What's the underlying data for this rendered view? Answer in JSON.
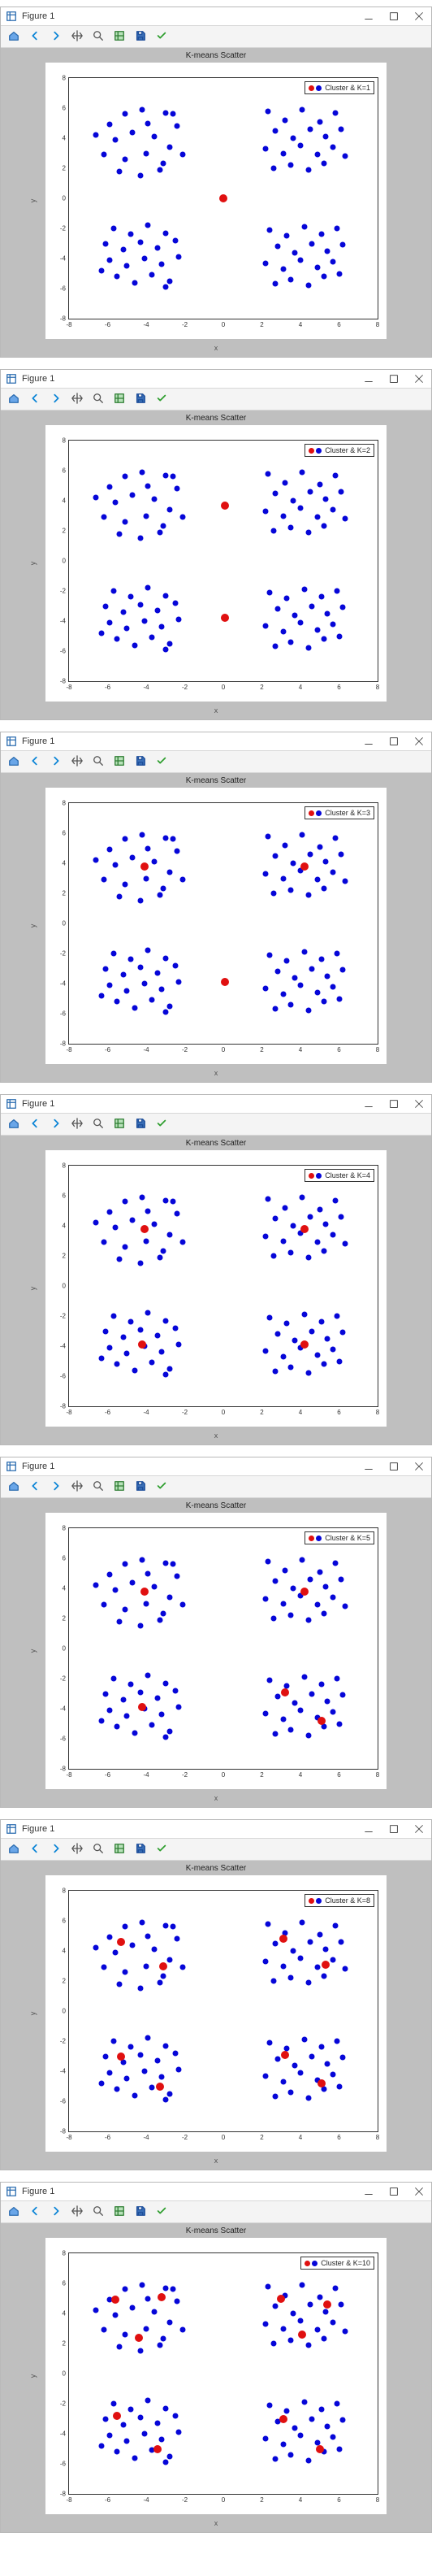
{
  "figure_window": {
    "title": "Figure 1",
    "buttons": {
      "minimize": "Minimize",
      "maximize": "Maximize",
      "close": "Close"
    },
    "toolbar": [
      {
        "name": "home-icon",
        "tip": "Reset original view"
      },
      {
        "name": "back-icon",
        "tip": "Back"
      },
      {
        "name": "forward-icon",
        "tip": "Forward"
      },
      {
        "name": "pan-icon",
        "tip": "Pan"
      },
      {
        "name": "zoom-icon",
        "tip": "Zoom"
      },
      {
        "name": "configure-icon",
        "tip": "Configure subplots"
      },
      {
        "name": "save-icon",
        "tip": "Save"
      },
      {
        "name": "check-icon",
        "tip": "Apply"
      }
    ]
  },
  "common_chart": {
    "title": "K-means Scatter",
    "xlabel": "x",
    "ylabel": "y",
    "xlim": [
      -8,
      8
    ],
    "ylim": [
      -8,
      8
    ],
    "xticks": [
      -8,
      -6,
      -4,
      -2,
      0,
      2,
      4,
      6,
      8
    ],
    "yticks": [
      -8,
      -6,
      -4,
      -2,
      0,
      2,
      4,
      6,
      8
    ],
    "legend_colors": {
      "centroid": "#e01010",
      "point": "#0606d8"
    }
  },
  "blue_points": [
    [
      -5.9,
      4.9
    ],
    [
      -5.1,
      5.6
    ],
    [
      -4.2,
      5.9
    ],
    [
      -3.0,
      5.7
    ],
    [
      -2.4,
      4.8
    ],
    [
      -5.6,
      3.9
    ],
    [
      -4.7,
      4.4
    ],
    [
      -3.6,
      4.1
    ],
    [
      -2.8,
      3.4
    ],
    [
      -6.2,
      2.9
    ],
    [
      -5.1,
      2.6
    ],
    [
      -4.0,
      3.0
    ],
    [
      -3.1,
      2.3
    ],
    [
      -2.1,
      2.9
    ],
    [
      -5.4,
      1.8
    ],
    [
      -4.3,
      1.5
    ],
    [
      -3.3,
      1.9
    ],
    [
      -6.6,
      4.2
    ],
    [
      -3.9,
      5.0
    ],
    [
      -2.6,
      5.6
    ],
    [
      2.3,
      5.8
    ],
    [
      3.2,
      5.2
    ],
    [
      4.1,
      5.9
    ],
    [
      5.0,
      5.1
    ],
    [
      5.8,
      5.7
    ],
    [
      2.7,
      4.5
    ],
    [
      3.6,
      4.0
    ],
    [
      4.5,
      4.6
    ],
    [
      5.3,
      4.1
    ],
    [
      6.1,
      4.6
    ],
    [
      2.2,
      3.3
    ],
    [
      3.1,
      3.0
    ],
    [
      4.0,
      3.5
    ],
    [
      4.9,
      2.9
    ],
    [
      5.7,
      3.4
    ],
    [
      3.5,
      2.2
    ],
    [
      4.4,
      1.9
    ],
    [
      5.2,
      2.3
    ],
    [
      6.3,
      2.8
    ],
    [
      2.6,
      2.0
    ],
    [
      -5.7,
      -2.0
    ],
    [
      -4.8,
      -2.4
    ],
    [
      -3.9,
      -1.8
    ],
    [
      -3.0,
      -2.3
    ],
    [
      -6.1,
      -3.0
    ],
    [
      -5.2,
      -3.4
    ],
    [
      -4.3,
      -2.9
    ],
    [
      -3.4,
      -3.3
    ],
    [
      -2.5,
      -2.8
    ],
    [
      -5.9,
      -4.1
    ],
    [
      -5.0,
      -4.5
    ],
    [
      -4.1,
      -4.0
    ],
    [
      -3.2,
      -4.4
    ],
    [
      -2.3,
      -3.9
    ],
    [
      -5.5,
      -5.2
    ],
    [
      -4.6,
      -5.6
    ],
    [
      -3.7,
      -5.1
    ],
    [
      -2.8,
      -5.5
    ],
    [
      -6.3,
      -4.8
    ],
    [
      -3.0,
      -5.9
    ],
    [
      2.4,
      -2.1
    ],
    [
      3.3,
      -2.5
    ],
    [
      4.2,
      -1.9
    ],
    [
      5.1,
      -2.4
    ],
    [
      5.9,
      -2.0
    ],
    [
      2.8,
      -3.2
    ],
    [
      3.7,
      -3.6
    ],
    [
      4.6,
      -3.0
    ],
    [
      5.4,
      -3.5
    ],
    [
      6.2,
      -3.1
    ],
    [
      2.2,
      -4.3
    ],
    [
      3.1,
      -4.7
    ],
    [
      4.0,
      -4.1
    ],
    [
      4.9,
      -4.6
    ],
    [
      5.7,
      -4.2
    ],
    [
      3.5,
      -5.4
    ],
    [
      4.4,
      -5.8
    ],
    [
      5.2,
      -5.2
    ],
    [
      2.7,
      -5.7
    ],
    [
      6.0,
      -5.0
    ]
  ],
  "chart_data": [
    {
      "type": "scatter",
      "k": 1,
      "legend": "Cluster & K=1",
      "centroids": [
        [
          0.0,
          0.0
        ]
      ]
    },
    {
      "type": "scatter",
      "k": 2,
      "legend": "Cluster & K=2",
      "centroids": [
        [
          0.1,
          3.7
        ],
        [
          0.1,
          -3.8
        ]
      ]
    },
    {
      "type": "scatter",
      "k": 3,
      "legend": "Cluster & K=3",
      "centroids": [
        [
          -4.1,
          3.8
        ],
        [
          4.2,
          3.8
        ],
        [
          0.1,
          -3.9
        ]
      ]
    },
    {
      "type": "scatter",
      "k": 4,
      "legend": "Cluster & K=4",
      "centroids": [
        [
          -4.1,
          3.8
        ],
        [
          4.2,
          3.8
        ],
        [
          -4.2,
          -3.9
        ],
        [
          4.2,
          -3.9
        ]
      ]
    },
    {
      "type": "scatter",
      "k": 5,
      "legend": "Cluster & K=5",
      "centroids": [
        [
          -4.1,
          3.8
        ],
        [
          4.2,
          3.8
        ],
        [
          -4.2,
          -3.9
        ],
        [
          3.2,
          -2.9
        ],
        [
          5.1,
          -4.8
        ]
      ]
    },
    {
      "type": "scatter",
      "k": 8,
      "legend": "Cluster & K=8",
      "centroids": [
        [
          -5.3,
          4.6
        ],
        [
          -3.1,
          3.0
        ],
        [
          3.1,
          4.8
        ],
        [
          5.3,
          3.1
        ],
        [
          -5.3,
          -3.0
        ],
        [
          -3.3,
          -5.0
        ],
        [
          3.2,
          -2.9
        ],
        [
          5.1,
          -4.8
        ]
      ]
    },
    {
      "type": "scatter",
      "k": 10,
      "legend": "Cluster & K=10",
      "centroids": [
        [
          -5.6,
          4.9
        ],
        [
          -3.2,
          5.1
        ],
        [
          -4.4,
          2.4
        ],
        [
          3.0,
          5.0
        ],
        [
          5.4,
          4.6
        ],
        [
          4.1,
          2.6
        ],
        [
          -5.5,
          -2.8
        ],
        [
          -3.4,
          -5.0
        ],
        [
          3.1,
          -3.0
        ],
        [
          5.0,
          -5.0
        ]
      ]
    }
  ]
}
